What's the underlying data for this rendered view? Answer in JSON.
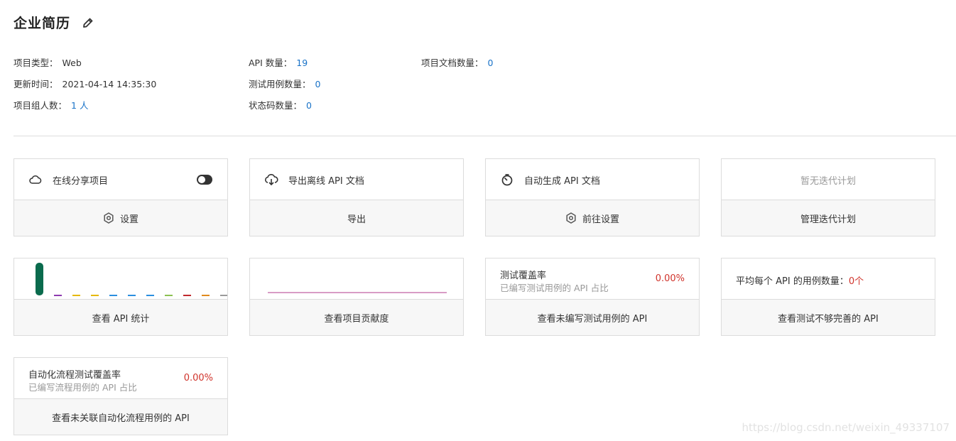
{
  "header": {
    "title": "企业简历",
    "edit_icon": "pencil-icon"
  },
  "meta": {
    "project_type_label": "项目类型：",
    "project_type_value": "Web",
    "updated_label": "更新时间：",
    "updated_value": "2021-04-14 14:35:30",
    "members_label": "项目组人数：",
    "members_value": "1 人",
    "api_count_label": "API 数量：",
    "api_count_value": "19",
    "test_cases_label": "测试用例数量：",
    "test_cases_value": "0",
    "status_codes_label": "状态码数量：",
    "status_codes_value": "0",
    "docs_label": "项目文档数量：",
    "docs_value": "0"
  },
  "cards": {
    "share": {
      "label": "在线分享项目",
      "icon": "cloud-icon",
      "action": "设置",
      "action_icon": "gear-icon"
    },
    "export": {
      "label": "导出离线 API 文档",
      "icon": "cloud-download-icon",
      "action": "导出"
    },
    "autogen": {
      "label": "自动生成 API 文档",
      "icon": "timer-icon",
      "action": "前往设置",
      "action_icon": "gear-icon"
    },
    "iteration": {
      "label": "暂无迭代计划",
      "action": "管理迭代计划"
    },
    "api_stats": {
      "action": "查看 API 统计"
    },
    "contribution": {
      "action": "查看项目贡献度"
    },
    "coverage": {
      "title": "测试覆盖率",
      "subtitle": "已编写测试用例的 API 占比",
      "percent": "0.00%",
      "action": "查看未编写测试用例的 API"
    },
    "avg_cases": {
      "label": "平均每个 API 的用例数量：",
      "value": "0个",
      "action": "查看测试不够完善的 API"
    },
    "flow_coverage": {
      "title": "自动化流程测试覆盖率",
      "subtitle": "已编写流程用例的 API 占比",
      "percent": "0.00%",
      "action": "查看未关联自动化流程用例的 API"
    }
  },
  "colors": {
    "link": "#1a73c8",
    "danger": "#d0332b",
    "bar_main": "#0a6b4d",
    "contribution_line": "#b13a8c"
  },
  "mini_bars": {
    "colors": [
      "#0a6b4d",
      "#8e3bb0",
      "#e6b800",
      "#e6b800",
      "#2b8fdf",
      "#2b8fdf",
      "#2b8fdf",
      "#8cc152",
      "#c0292d",
      "#e08a1e",
      "#9a9a9a"
    ],
    "values": [
      19,
      0,
      0,
      0,
      0,
      0,
      0,
      0,
      0,
      0,
      0
    ]
  },
  "watermark": "https://blog.csdn.net/weixin_49337107"
}
